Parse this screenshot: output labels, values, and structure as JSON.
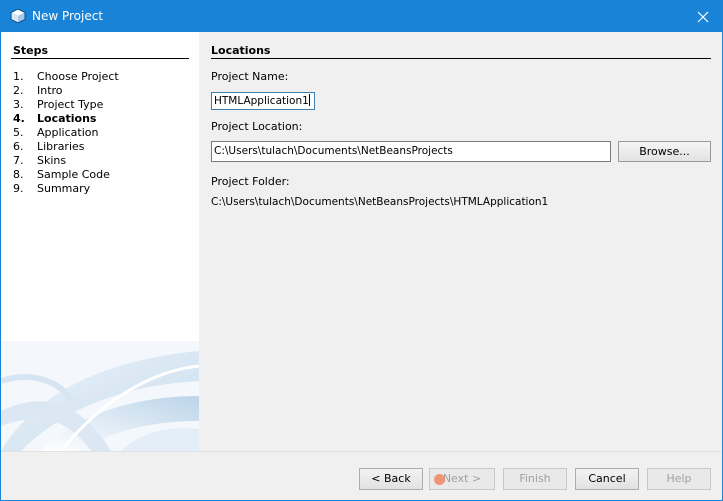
{
  "window": {
    "title": "New Project",
    "icon": "netbeans-cube-icon",
    "close_icon": "close-icon",
    "accent": "#1883d7"
  },
  "steps": {
    "title": "Steps",
    "items": [
      {
        "num": "1.",
        "label": "Choose Project"
      },
      {
        "num": "2.",
        "label": "Intro"
      },
      {
        "num": "3.",
        "label": "Project Type"
      },
      {
        "num": "4.",
        "label": "Locations",
        "active": true
      },
      {
        "num": "5.",
        "label": "Application"
      },
      {
        "num": "6.",
        "label": "Libraries"
      },
      {
        "num": "7.",
        "label": "Skins"
      },
      {
        "num": "8.",
        "label": "Sample Code"
      },
      {
        "num": "9.",
        "label": "Summary"
      }
    ]
  },
  "main": {
    "title": "Locations",
    "project_name_label": "Project Name:",
    "project_name_value": "HTMLApplication1",
    "project_location_label": "Project Location:",
    "project_location_value": "C:\\Users\\tulach\\Documents\\NetBeansProjects",
    "browse_label": "Browse...",
    "project_folder_label": "Project Folder:",
    "project_folder_value": "C:\\Users\\tulach\\Documents\\NetBeansProjects\\HTMLApplication1"
  },
  "footer": {
    "back_label": "< Back",
    "next_label": "Next >",
    "finish_label": "Finish",
    "cancel_label": "Cancel",
    "help_label": "Help"
  }
}
